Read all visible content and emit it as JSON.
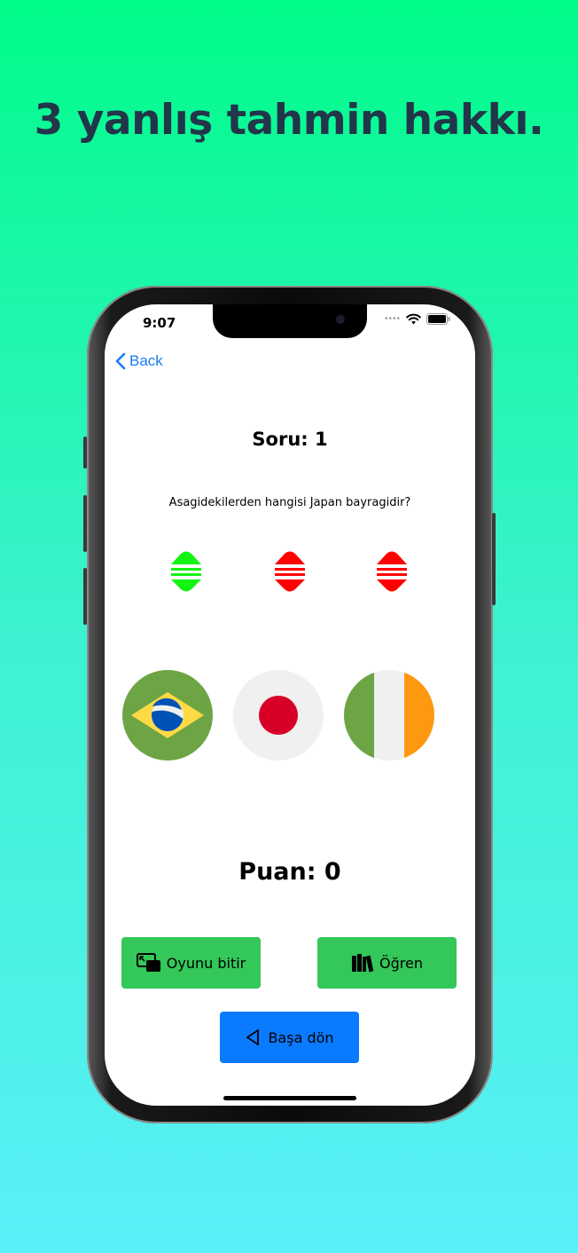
{
  "promo": {
    "headline": "3 yanlış tahmin hakkı."
  },
  "status_bar": {
    "time": "9:07",
    "icons": [
      "signal-dots",
      "wifi-icon",
      "battery-icon"
    ]
  },
  "nav": {
    "back_label": "Back"
  },
  "quiz": {
    "question_number_label": "Soru: 1",
    "question_text": "Asagidekilerden hangisi Japan bayragidir?",
    "lives": [
      {
        "state": "remaining",
        "color": "#13f413"
      },
      {
        "state": "lost",
        "color": "#ff0000"
      },
      {
        "state": "lost",
        "color": "#ff0000"
      }
    ],
    "flags": [
      {
        "name": "brazil-flag",
        "country": "Brazil"
      },
      {
        "name": "japan-flag",
        "country": "Japan"
      },
      {
        "name": "ireland-flag",
        "country": "Ireland"
      }
    ],
    "score_label": "Puan: 0"
  },
  "actions": {
    "end_game_label": "Oyunu bitir",
    "learn_label": "Öğren",
    "restart_label": "Başa dön"
  },
  "colors": {
    "green_button": "#34c759",
    "blue_button": "#0a7aff",
    "link": "#1a7cf5"
  }
}
